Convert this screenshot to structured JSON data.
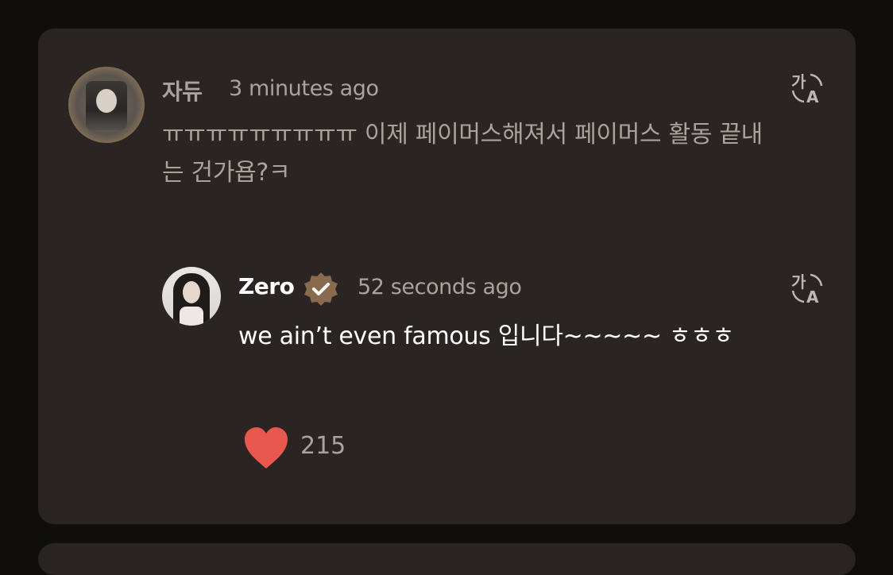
{
  "comment": {
    "username": "자듀",
    "timestamp": "3 minutes ago",
    "text": "ㅠㅠㅠㅠㅠㅠㅠㅠㅠ 이제 페이머스해져서 페이머스 활동 끝내는 건가욥?ㅋ",
    "translate_icon": "translate-icon"
  },
  "reply": {
    "username": "Zero",
    "verified_icon": "verified-badge-icon",
    "timestamp": "52 seconds ago",
    "text": "we ain’t even famous 입니다~~~~~ ㅎㅎㅎ",
    "translate_icon": "translate-icon",
    "likes": "215",
    "heart_color": "#e8584f",
    "badge_color": "#8a6a4f"
  }
}
